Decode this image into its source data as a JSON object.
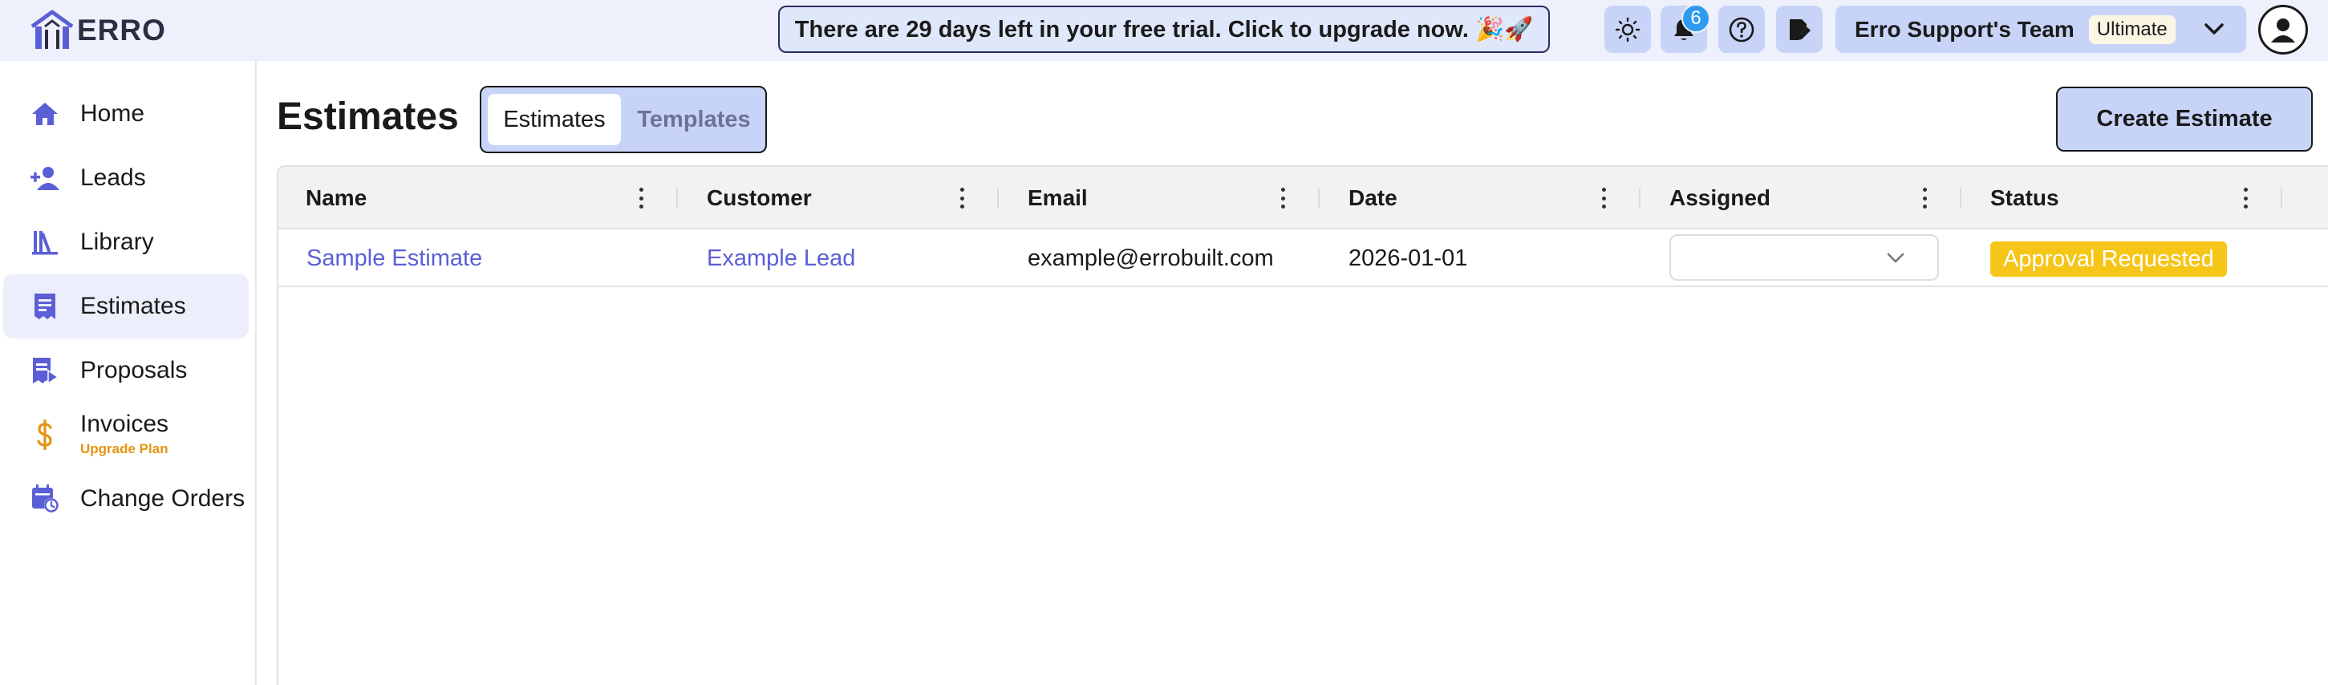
{
  "header": {
    "logo_text": "ERRO",
    "trial_banner": "There are 29 days left in your free trial. Click to upgrade now. 🎉🚀",
    "notifications_count": "6",
    "team_name": "Erro Support's Team",
    "plan_badge": "Ultimate"
  },
  "sidebar": {
    "items": [
      {
        "label": "Home",
        "icon": "home-icon"
      },
      {
        "label": "Leads",
        "icon": "user-plus-icon"
      },
      {
        "label": "Library",
        "icon": "library-icon"
      },
      {
        "label": "Estimates",
        "icon": "receipt-icon",
        "active": true
      },
      {
        "label": "Proposals",
        "icon": "proposal-icon"
      },
      {
        "label": "Invoices",
        "icon": "dollar-icon",
        "sublabel": "Upgrade Plan"
      },
      {
        "label": "Change Orders",
        "icon": "calendar-clock-icon"
      }
    ]
  },
  "main": {
    "title": "Estimates",
    "tabs": [
      {
        "label": "Estimates",
        "selected": true
      },
      {
        "label": "Templates",
        "selected": false
      }
    ],
    "create_button": "Create Estimate",
    "table": {
      "columns": [
        "Name",
        "Customer",
        "Email",
        "Date",
        "Assigned",
        "Status"
      ],
      "rows": [
        {
          "name": "Sample Estimate",
          "customer": "Example Lead",
          "email": "example@errobuilt.com",
          "date": "2026-01-01",
          "assigned": "",
          "status": "Approval Requested"
        }
      ]
    }
  },
  "colors": {
    "accent": "#5b5fd6",
    "button_bg": "#c8d4f7",
    "topbar_bg": "#eef1fb",
    "status_approval": "#f5c518",
    "upgrade_orange": "#e39512"
  }
}
